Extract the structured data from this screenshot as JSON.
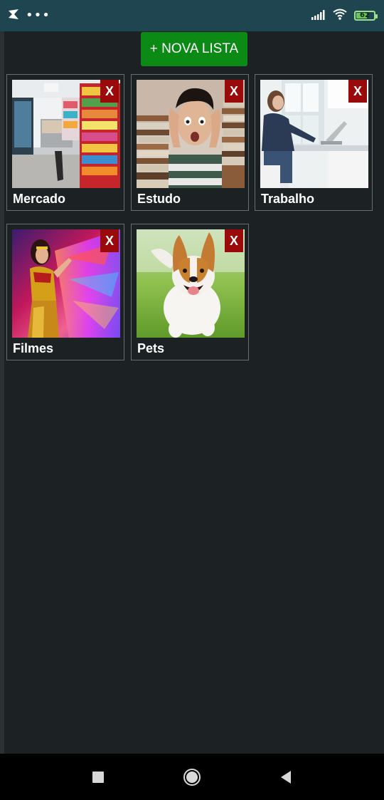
{
  "status_bar": {
    "overflow_dots": "•••",
    "battery_level": 62,
    "battery_text": "62",
    "icons": [
      "app-notification-icon",
      "signal-icon",
      "wifi-icon",
      "battery-icon"
    ]
  },
  "toolbar": {
    "new_list_label": "+ NOVA LISTA"
  },
  "lists": [
    {
      "label": "Mercado",
      "delete_label": "X",
      "image": "grocery-store-photo"
    },
    {
      "label": "Estudo",
      "delete_label": "X",
      "image": "stressed-student-books-photo"
    },
    {
      "label": "Trabalho",
      "delete_label": "X",
      "image": "woman-at-laptop-office-photo"
    },
    {
      "label": "Filmes",
      "delete_label": "X",
      "image": "wonder-woman-poster"
    },
    {
      "label": "Pets",
      "delete_label": "X",
      "image": "running-dog-photo"
    }
  ],
  "nav_bar": {
    "icons": [
      "recent-apps-icon",
      "home-icon",
      "back-icon"
    ]
  },
  "colors": {
    "status_bar": "#1f4650",
    "background": "#1c2124",
    "accent_button": "#0c8a16",
    "delete_button": "#9a0a0a",
    "card_border": "#6a6e70"
  }
}
